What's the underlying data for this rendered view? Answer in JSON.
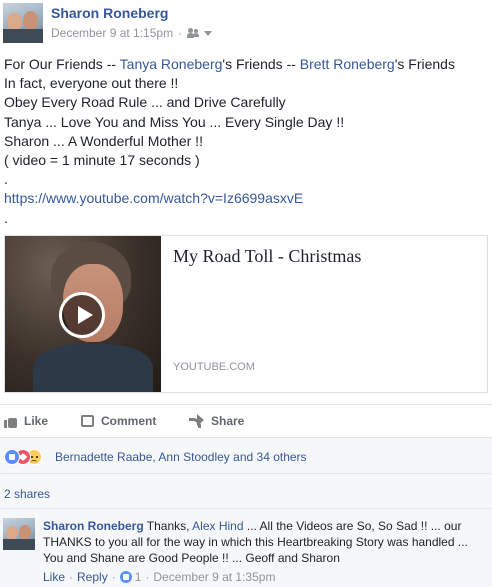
{
  "post": {
    "author": "Sharon Roneberg",
    "timestamp": "December 9 at 1:15pm",
    "separator": "·",
    "audience_icon": "friends-icon",
    "lines": {
      "l1_pre": "For Our Friends -- ",
      "l1_link1": "Tanya Roneberg",
      "l1_mid": "'s Friends -- ",
      "l1_link2": "Brett Roneberg",
      "l1_post": "'s Friends",
      "l2": "In fact, everyone out there !!",
      "l3": "Obey Every Road Rule ... and Drive Carefully",
      "l4": "Tanya ... Love You and Miss You ... Every Single Day !!",
      "l5": "Sharon ... A Wonderful Mother !!",
      "l6": "( video = 1 minute 17 seconds )",
      "l7": ".",
      "l8": "https://www.youtube.com/watch?v=Iz6699asxvE",
      "l9": "."
    }
  },
  "link_card": {
    "title": "My Road Toll - Christmas",
    "domain": "YOUTUBE.COM"
  },
  "actions": {
    "like": "Like",
    "comment": "Comment",
    "share": "Share"
  },
  "reactions": {
    "icons": [
      "like-icon",
      "love-icon",
      "sad-icon"
    ],
    "name1": "Bernadette Raabe",
    "sep": ", ",
    "name2": "Ann Stoodley",
    "and": " and ",
    "others": "34 others"
  },
  "shares": "2 shares",
  "comment": {
    "author": "Sharon Roneberg",
    "pre": " Thanks, ",
    "mention": "Alex Hind",
    "text": " ... All the Videos are So, So Sad !! ... our THANKS to you all for the way in which this Heartbreaking Story was handled ... You and Shane are Good People !! ... Geoff and Sharon",
    "like": "Like",
    "dot": "·",
    "reply": "Reply",
    "like_count": "1",
    "timestamp": "December 9 at 1:35pm"
  },
  "colors": {
    "link": "#365899",
    "meta": "#90949c",
    "text": "#1d2129",
    "like_blue": "#5890ff",
    "love_red": "#f25268",
    "sad_yellow": "#fbcd5a"
  }
}
